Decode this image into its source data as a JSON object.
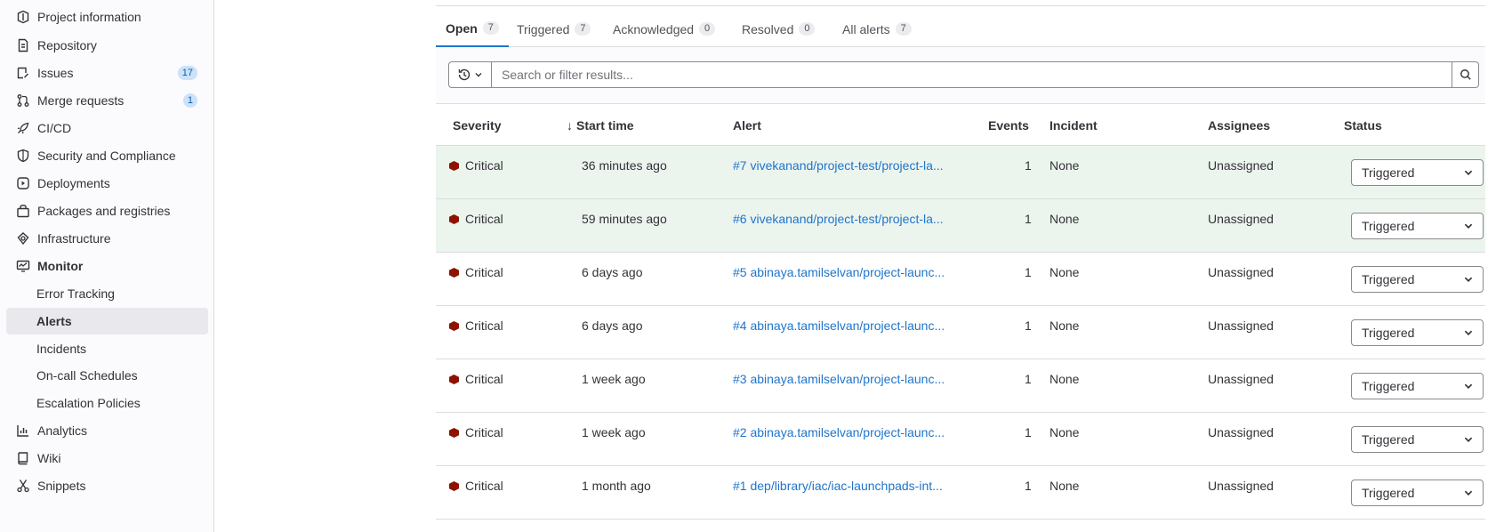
{
  "sidebar": {
    "items": [
      {
        "label": "Project information",
        "icon": "project-icon"
      },
      {
        "label": "Repository",
        "icon": "doc-text-icon"
      },
      {
        "label": "Issues",
        "icon": "issues-icon",
        "badge": "17"
      },
      {
        "label": "Merge requests",
        "icon": "merge-request-icon",
        "badge": "1"
      },
      {
        "label": "CI/CD",
        "icon": "rocket-icon"
      },
      {
        "label": "Security and Compliance",
        "icon": "shield-icon"
      },
      {
        "label": "Deployments",
        "icon": "deployments-icon"
      },
      {
        "label": "Packages and registries",
        "icon": "package-icon"
      },
      {
        "label": "Infrastructure",
        "icon": "cloud-gear-icon"
      },
      {
        "label": "Monitor",
        "icon": "monitor-icon"
      },
      {
        "label": "Error Tracking"
      },
      {
        "label": "Alerts"
      },
      {
        "label": "Incidents"
      },
      {
        "label": "On-call Schedules"
      },
      {
        "label": "Escalation Policies"
      },
      {
        "label": "Analytics",
        "icon": "chart-icon"
      },
      {
        "label": "Wiki",
        "icon": "book-icon"
      },
      {
        "label": "Snippets",
        "icon": "snippet-icon"
      }
    ]
  },
  "tabs": [
    {
      "label": "Open",
      "count": "7"
    },
    {
      "label": "Triggered",
      "count": "7"
    },
    {
      "label": "Acknowledged",
      "count": "0"
    },
    {
      "label": "Resolved",
      "count": "0"
    },
    {
      "label": "All alerts",
      "count": "7"
    }
  ],
  "search": {
    "placeholder": "Search or filter results..."
  },
  "table": {
    "headers": {
      "severity": "Severity",
      "start_time": "Start time",
      "alert": "Alert",
      "events": "Events",
      "incident": "Incident",
      "assignees": "Assignees",
      "status": "Status"
    },
    "sort_indicator": "↓",
    "rows": [
      {
        "severity": "Critical",
        "start_time": "36 minutes ago",
        "alert": "#7 vivekanand/project-test/project-la...",
        "events": "1",
        "incident": "None",
        "assignees": "Unassigned",
        "status": "Triggered"
      },
      {
        "severity": "Critical",
        "start_time": "59 minutes ago",
        "alert": "#6 vivekanand/project-test/project-la...",
        "events": "1",
        "incident": "None",
        "assignees": "Unassigned",
        "status": "Triggered"
      },
      {
        "severity": "Critical",
        "start_time": "6 days ago",
        "alert": "#5 abinaya.tamilselvan/project-launc...",
        "events": "1",
        "incident": "None",
        "assignees": "Unassigned",
        "status": "Triggered"
      },
      {
        "severity": "Critical",
        "start_time": "6 days ago",
        "alert": "#4 abinaya.tamilselvan/project-launc...",
        "events": "1",
        "incident": "None",
        "assignees": "Unassigned",
        "status": "Triggered"
      },
      {
        "severity": "Critical",
        "start_time": "1 week ago",
        "alert": "#3 abinaya.tamilselvan/project-launc...",
        "events": "1",
        "incident": "None",
        "assignees": "Unassigned",
        "status": "Triggered"
      },
      {
        "severity": "Critical",
        "start_time": "1 week ago",
        "alert": "#2 abinaya.tamilselvan/project-launc...",
        "events": "1",
        "incident": "None",
        "assignees": "Unassigned",
        "status": "Triggered"
      },
      {
        "severity": "Critical",
        "start_time": "1 month ago",
        "alert": "#1 dep/library/iac/iac-launchpads-int...",
        "events": "1",
        "incident": "None",
        "assignees": "Unassigned",
        "status": "Triggered"
      }
    ]
  },
  "colors": {
    "accent": "#1f75cb",
    "critical": "#8d1300",
    "highlight_row": "#ecf4ee"
  }
}
